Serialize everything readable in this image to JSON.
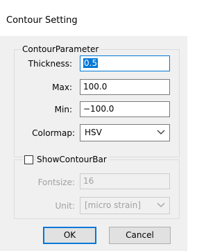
{
  "window": {
    "title": "Contour Setting"
  },
  "contour_group": {
    "legend": "ContourParameter",
    "thickness": {
      "label": "Thickness:",
      "value": "0.5"
    },
    "max": {
      "label": "Max:",
      "value": "100.0"
    },
    "min": {
      "label": "Min:",
      "value": "−100.0"
    },
    "colormap": {
      "label": "Colormap:",
      "value": "HSV"
    }
  },
  "contour_bar_group": {
    "checkbox_label": "ShowContourBar",
    "checked": false,
    "fontsize": {
      "label": "Fontsize:",
      "value": "16"
    },
    "unit": {
      "label": "Unit:",
      "value": "[micro strain]"
    }
  },
  "buttons": {
    "ok": "OK",
    "cancel": "Cancel"
  }
}
